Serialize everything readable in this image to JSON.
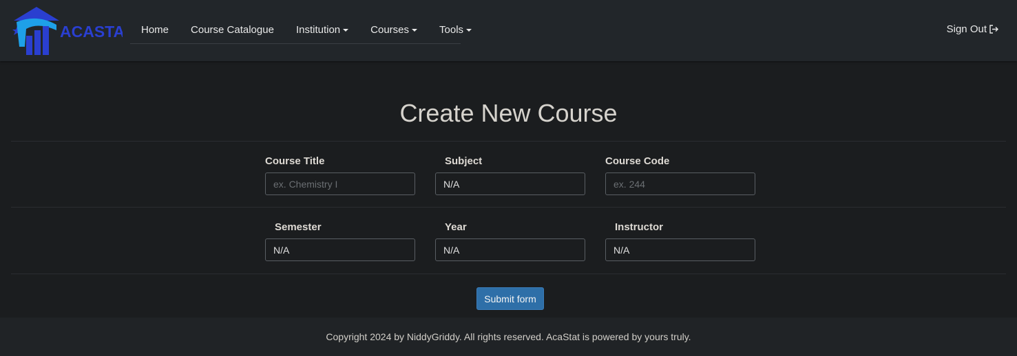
{
  "brand": {
    "name": "ACASTAT",
    "color": "#2a3fd0",
    "accent": "#1ea0e8"
  },
  "nav": {
    "items": [
      {
        "label": "Home",
        "dropdown": false
      },
      {
        "label": "Course Catalogue",
        "dropdown": false
      },
      {
        "label": "Institution",
        "dropdown": true
      },
      {
        "label": "Courses",
        "dropdown": true
      },
      {
        "label": "Tools",
        "dropdown": true
      }
    ],
    "signout_label": "Sign Out",
    "signout_icon": "sign-out-icon"
  },
  "page": {
    "title": "Create New Course"
  },
  "form": {
    "course_title": {
      "label": "Course Title",
      "value": "",
      "placeholder": "ex. Chemistry I"
    },
    "subject": {
      "label": "Subject",
      "value": "N/A",
      "placeholder": ""
    },
    "course_code": {
      "label": "Course Code",
      "value": "",
      "placeholder": "ex. 244"
    },
    "semester": {
      "label": "Semester",
      "value": "N/A",
      "placeholder": ""
    },
    "year": {
      "label": "Year",
      "value": "N/A",
      "placeholder": ""
    },
    "instructor": {
      "label": "Instructor",
      "value": "N/A",
      "placeholder": ""
    },
    "submit_label": "Submit form",
    "submit_color": "#2e6fa8"
  },
  "footer": {
    "text": "Copyright 2024 by NiddyGriddy. All rights reserved. AcaStat is powered by yours truly."
  }
}
